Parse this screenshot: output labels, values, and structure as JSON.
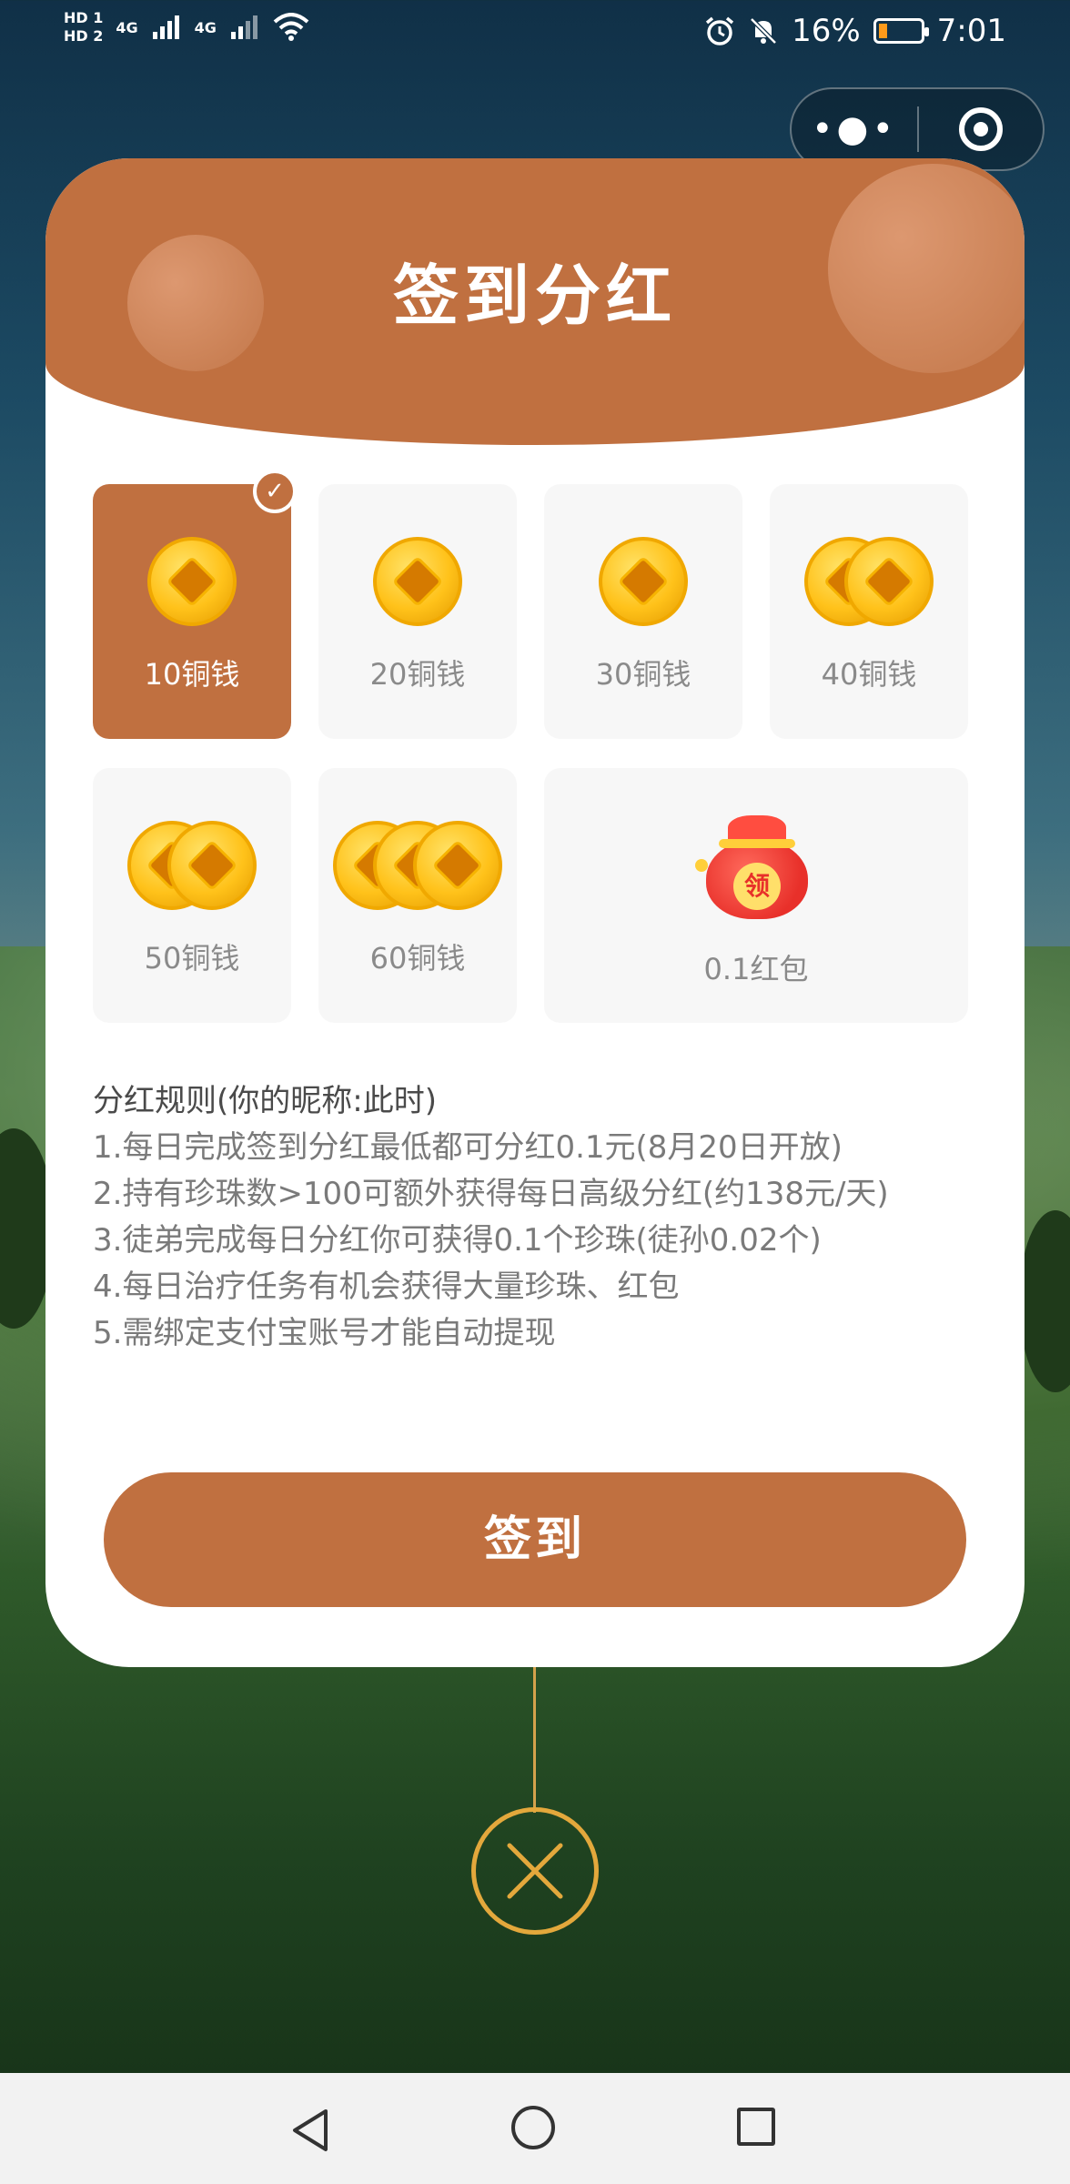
{
  "status_bar": {
    "sim1": "HD 1",
    "sim2": "HD 2",
    "net1": "4G",
    "net2": "4G",
    "battery_percent": "16%",
    "time": "7:01"
  },
  "capsule": {
    "more_icon": "more-dots-icon",
    "close_icon": "target-icon"
  },
  "modal": {
    "title": "签到分红",
    "rewards": [
      {
        "label": "10铜钱",
        "coins": 1,
        "selected": true
      },
      {
        "label": "20铜钱",
        "coins": 1,
        "selected": false
      },
      {
        "label": "30铜钱",
        "coins": 1,
        "selected": false
      },
      {
        "label": "40铜钱",
        "coins": 2,
        "selected": false
      },
      {
        "label": "50铜钱",
        "coins": 2,
        "selected": false
      },
      {
        "label": "60铜钱",
        "coins": 3,
        "selected": false
      },
      {
        "label": "0.1红包",
        "bag_text": "领",
        "selected": false
      }
    ],
    "rules_title": "分红规则(你的昵称:此时)",
    "rules": [
      "1.每日完成签到分红最低都可分红0.1元(8月20日开放)",
      "2.持有珍珠数>100可额外获得每日高级分红(约138元/天)",
      "3.徒弟完成每日分红你可获得0.1个珍珠(徒孙0.02个)",
      "4.每日治疗任务有机会获得大量珍珠、红包",
      "5.需绑定支付宝账号才能自动提现"
    ],
    "sign_button": "签到",
    "check_mark": "✓"
  },
  "colors": {
    "accent": "#c07040",
    "tile_bg": "#f7f7f7",
    "close_ring": "#e3a83c"
  }
}
